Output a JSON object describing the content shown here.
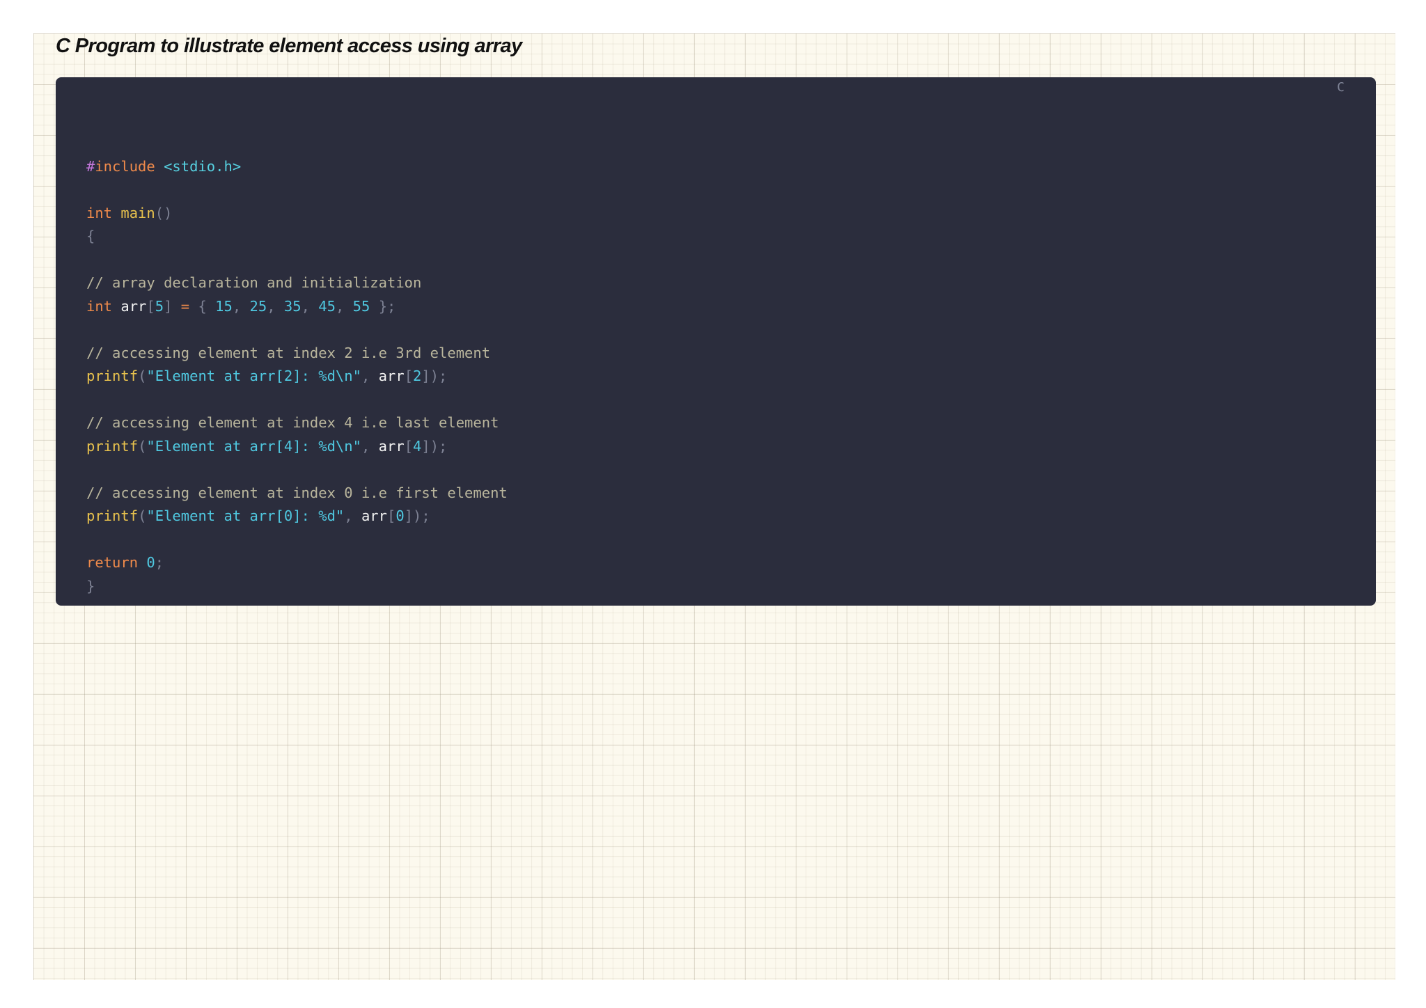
{
  "document": {
    "title": "C Program to illustrate element access using array"
  },
  "code_block": {
    "language_label": "C",
    "lines": [
      [],
      [
        {
          "t": "#",
          "k": "directive"
        },
        {
          "t": "include",
          "k": "keyword"
        },
        {
          "t": " ",
          "k": "plain"
        },
        {
          "t": "<stdio.h>",
          "k": "header"
        }
      ],
      [],
      [
        {
          "t": "int",
          "k": "keyword"
        },
        {
          "t": " ",
          "k": "plain"
        },
        {
          "t": "main",
          "k": "func"
        },
        {
          "t": "()",
          "k": "punct"
        }
      ],
      [
        {
          "t": "{",
          "k": "punct"
        }
      ],
      [],
      [
        {
          "t": "// array declaration and initialization",
          "k": "comment"
        }
      ],
      [
        {
          "t": "int",
          "k": "keyword"
        },
        {
          "t": " ",
          "k": "plain"
        },
        {
          "t": "arr",
          "k": "ident"
        },
        {
          "t": "[",
          "k": "punct"
        },
        {
          "t": "5",
          "k": "number"
        },
        {
          "t": "]",
          "k": "punct"
        },
        {
          "t": " ",
          "k": "plain"
        },
        {
          "t": "=",
          "k": "op"
        },
        {
          "t": " ",
          "k": "plain"
        },
        {
          "t": "{",
          "k": "punct"
        },
        {
          "t": " ",
          "k": "plain"
        },
        {
          "t": "15",
          "k": "number"
        },
        {
          "t": ",",
          "k": "punct"
        },
        {
          "t": " ",
          "k": "plain"
        },
        {
          "t": "25",
          "k": "number"
        },
        {
          "t": ",",
          "k": "punct"
        },
        {
          "t": " ",
          "k": "plain"
        },
        {
          "t": "35",
          "k": "number"
        },
        {
          "t": ",",
          "k": "punct"
        },
        {
          "t": " ",
          "k": "plain"
        },
        {
          "t": "45",
          "k": "number"
        },
        {
          "t": ",",
          "k": "punct"
        },
        {
          "t": " ",
          "k": "plain"
        },
        {
          "t": "55",
          "k": "number"
        },
        {
          "t": " ",
          "k": "plain"
        },
        {
          "t": "};",
          "k": "punct"
        }
      ],
      [],
      [
        {
          "t": "// accessing element at index 2 i.e 3rd element",
          "k": "comment"
        }
      ],
      [
        {
          "t": "printf",
          "k": "func"
        },
        {
          "t": "(",
          "k": "punct"
        },
        {
          "t": "\"Element at arr[2]: %d\\n\"",
          "k": "string"
        },
        {
          "t": ",",
          "k": "punct"
        },
        {
          "t": " ",
          "k": "plain"
        },
        {
          "t": "arr",
          "k": "ident"
        },
        {
          "t": "[",
          "k": "punct"
        },
        {
          "t": "2",
          "k": "number"
        },
        {
          "t": "]);",
          "k": "punct"
        }
      ],
      [],
      [
        {
          "t": "// accessing element at index 4 i.e last element",
          "k": "comment"
        }
      ],
      [
        {
          "t": "printf",
          "k": "func"
        },
        {
          "t": "(",
          "k": "punct"
        },
        {
          "t": "\"Element at arr[4]: %d\\n\"",
          "k": "string"
        },
        {
          "t": ",",
          "k": "punct"
        },
        {
          "t": " ",
          "k": "plain"
        },
        {
          "t": "arr",
          "k": "ident"
        },
        {
          "t": "[",
          "k": "punct"
        },
        {
          "t": "4",
          "k": "number"
        },
        {
          "t": "]);",
          "k": "punct"
        }
      ],
      [],
      [
        {
          "t": "// accessing element at index 0 i.e first element",
          "k": "comment"
        }
      ],
      [
        {
          "t": "printf",
          "k": "func"
        },
        {
          "t": "(",
          "k": "punct"
        },
        {
          "t": "\"Element at arr[0]: %d\"",
          "k": "string"
        },
        {
          "t": ",",
          "k": "punct"
        },
        {
          "t": " ",
          "k": "plain"
        },
        {
          "t": "arr",
          "k": "ident"
        },
        {
          "t": "[",
          "k": "punct"
        },
        {
          "t": "0",
          "k": "number"
        },
        {
          "t": "]);",
          "k": "punct"
        }
      ],
      [],
      [
        {
          "t": "return",
          "k": "keyword"
        },
        {
          "t": " ",
          "k": "plain"
        },
        {
          "t": "0",
          "k": "number"
        },
        {
          "t": ";",
          "k": "punct"
        }
      ],
      [
        {
          "t": "}",
          "k": "punct"
        }
      ]
    ]
  }
}
